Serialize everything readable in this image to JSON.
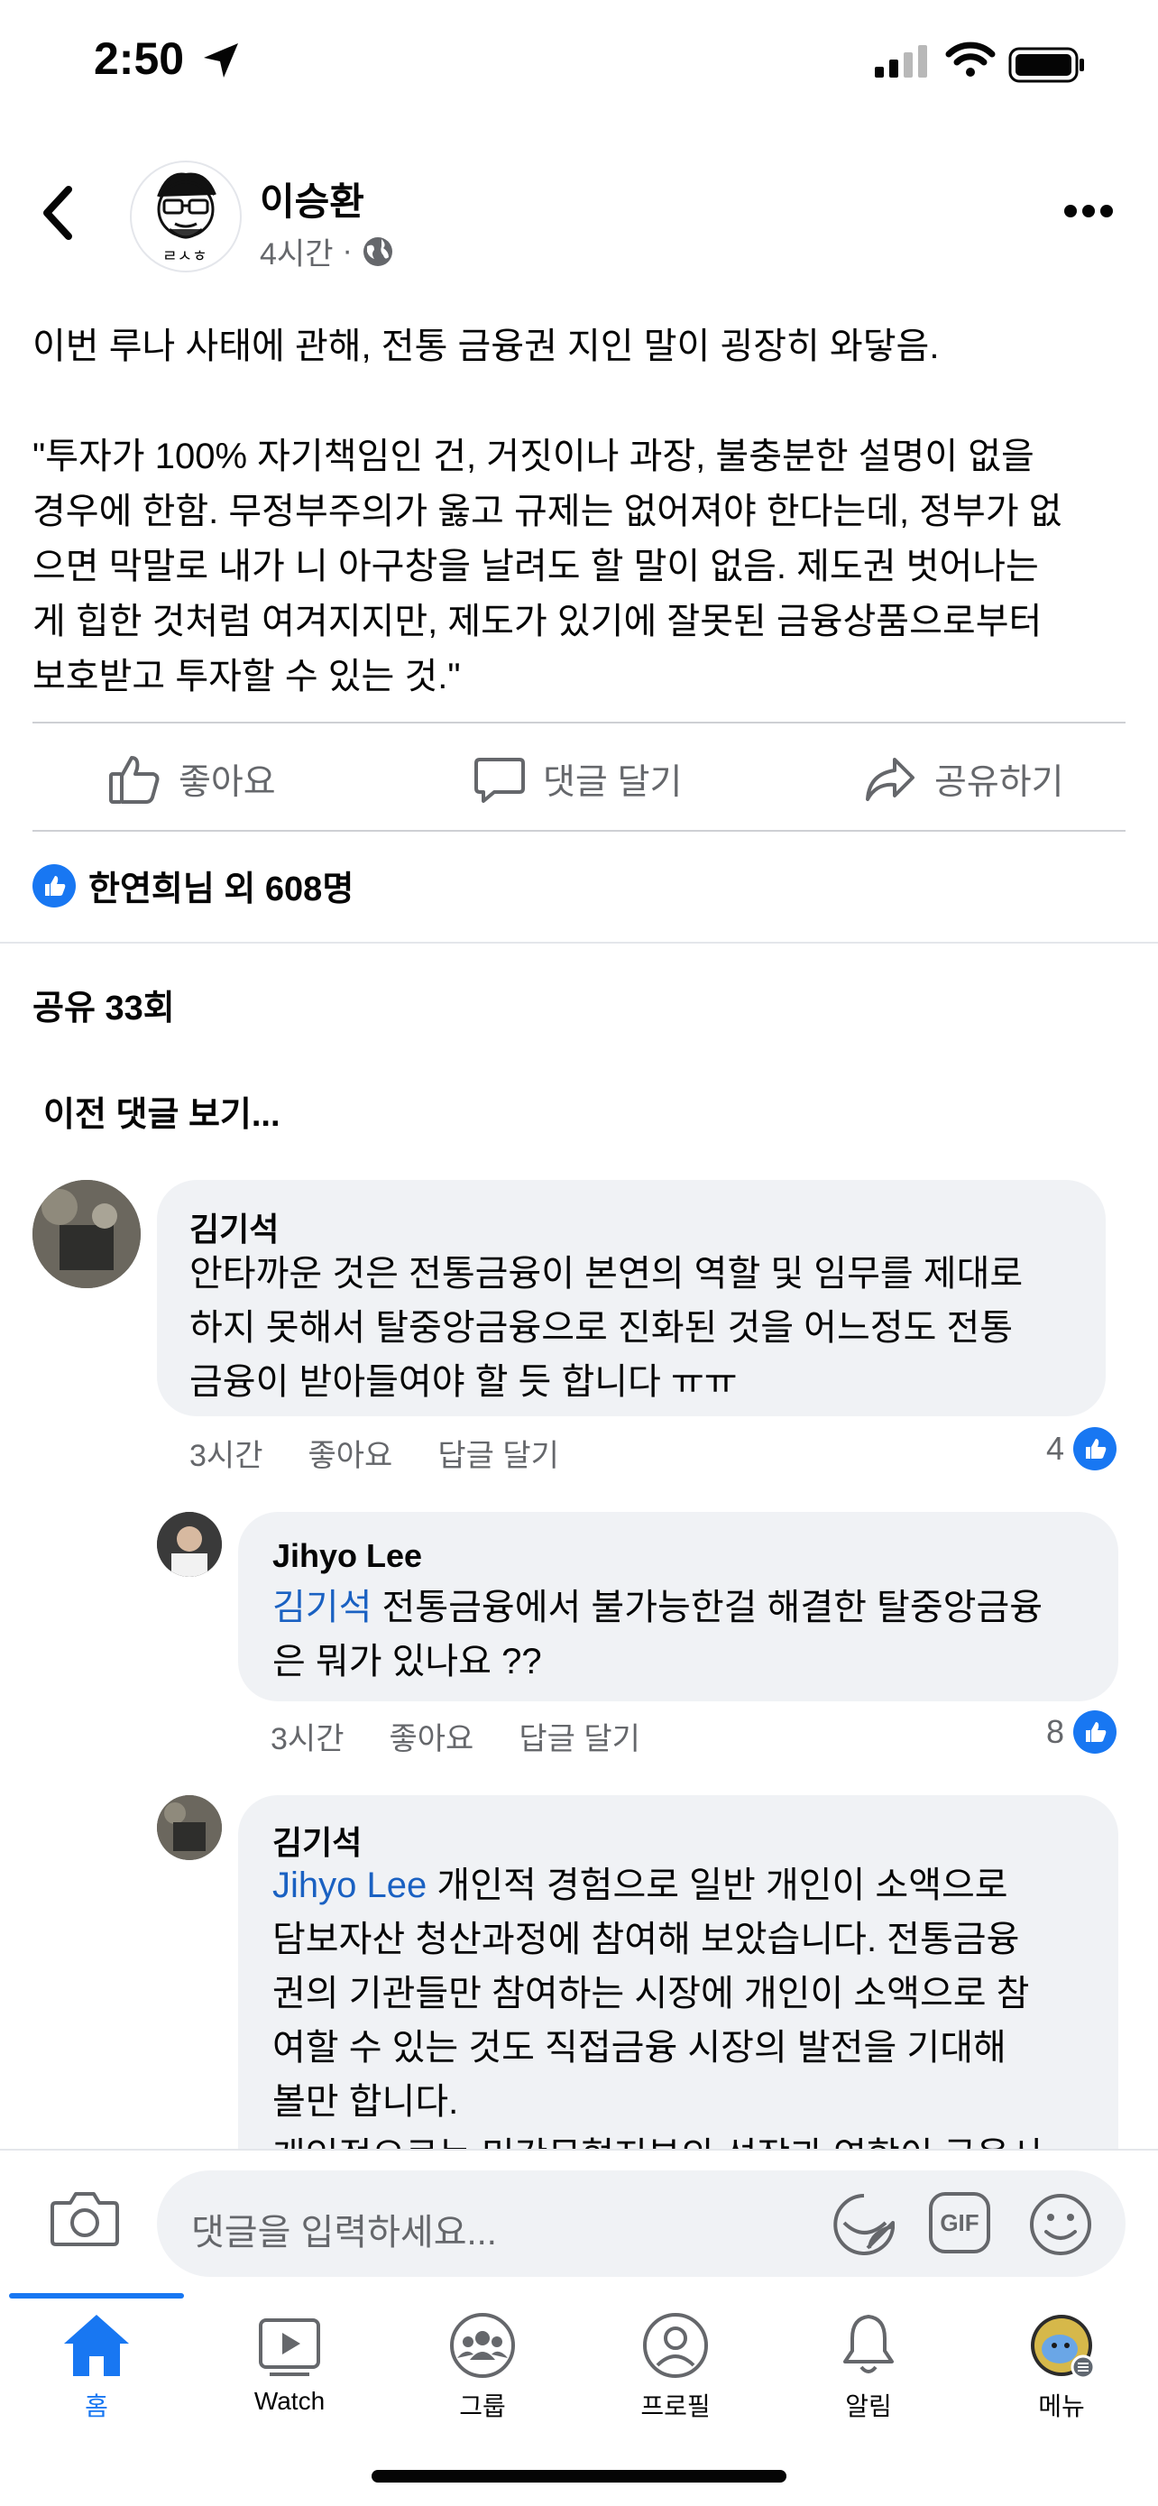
{
  "status_bar": {
    "time": "2:50"
  },
  "post": {
    "author": "이승환",
    "avatar_text": "ㄹㅅㅎ",
    "time": "4시간",
    "separator": "·",
    "text": "이번 루나 사태에 관해, 전통 금융권 지인 말이 굉장히 와닿음.\n\n\"투자가 100% 자기책임인 건, 거짓이나 과장, 불충분한 설명이 없을\n경우에 한함. 무정부주의가 옳고 규제는 없어져야 한다는데, 정부가 없\n으면 막말로 내가 니 아구창을 날려도 할 말이 없음. 제도권 벗어나는\n게 힙한 것처럼 여겨지지만, 제도가 있기에 잘못된 금융상품으로부터\n보호받고 투자할 수 있는 것.\""
  },
  "actions": {
    "like": "좋아요",
    "comment": "댓글 달기",
    "share": "공유하기"
  },
  "reactions_text": "한연희님 외 608명",
  "shares_text": "공유 33회",
  "prev_comments": "이전 댓글 보기...",
  "comments": [
    {
      "name": "김기석",
      "text": "안타까운 것은 전통금융이 본연의 역할 및 임무를 제대로\n하지 못해서 탈중앙금융으로 진화된 것을 어느정도 전통\n금융이 받아들여야 할 듯 합니다 ㅠㅠ",
      "time": "3시간",
      "like": "좋아요",
      "reply": "답글 달기",
      "likes": "4"
    },
    {
      "name": "Jihyo Lee",
      "mention": "김기석",
      "text": " 전통금융에서 불가능한걸 해결한 탈중앙금융\n은 뭐가 있나요 ??",
      "time": "3시간",
      "like": "좋아요",
      "reply": "답글 달기",
      "likes": "8"
    },
    {
      "name": "김기석",
      "mention": "Jihyo Lee",
      "text": " 개인적 경험으로 일반 개인이 소액으로\n담보자산 청산과정에 참여해 보았습니다. 전통금융\n권의 기관들만 참여하는 시장에 개인이 소액으로 참\n여할 수 있는 것도 직접금융 시장의 발전을 기대해\n볼만 합니다.\n개인적으로는 민간무협지부의 성장과 연합이 금융시"
    }
  ],
  "composer": {
    "placeholder": "댓글을 입력하세요...",
    "gif": "GIF"
  },
  "tabs": [
    {
      "label": "홈",
      "icon": "home-icon"
    },
    {
      "label": "Watch",
      "icon": "watch-icon"
    },
    {
      "label": "그룹",
      "icon": "groups-icon"
    },
    {
      "label": "프로필",
      "icon": "profile-icon"
    },
    {
      "label": "알림",
      "icon": "bell-icon"
    },
    {
      "label": "메뉴",
      "icon": "menu-icon"
    }
  ],
  "colors": {
    "accent": "#1877f2",
    "mention": "#1a61c2",
    "bubble": "#f0f2f5",
    "muted": "#65676b"
  }
}
